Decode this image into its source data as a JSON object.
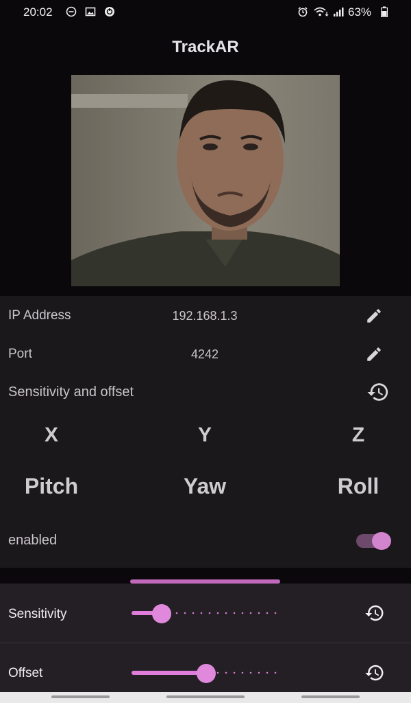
{
  "status_bar": {
    "time": "20:02",
    "battery": "63%",
    "left_icons": [
      "do-not-disturb-icon",
      "image-icon",
      "sync-icon"
    ],
    "right_icons": [
      "alarm-icon",
      "wifi-icon",
      "signal-icon",
      "battery-icon"
    ]
  },
  "app": {
    "title": "TrackAR"
  },
  "settings": {
    "ip": {
      "label": "IP Address",
      "value": "192.168.1.3"
    },
    "port": {
      "label": "Port",
      "value": "4242"
    },
    "sensitivity_offset": {
      "label": "Sensitivity and offset"
    }
  },
  "axes": [
    "X",
    "Y",
    "Z"
  ],
  "rotations": [
    "Pitch",
    "Yaw",
    "Roll"
  ],
  "enabled": {
    "label": "enabled",
    "on": true
  },
  "sheet": {
    "sensitivity": {
      "label": "Sensitivity",
      "value_fraction": 0.2
    },
    "offset": {
      "label": "Offset",
      "value_fraction": 0.5
    }
  },
  "colors": {
    "accent": "#e07ddb",
    "background": "#0b080c",
    "panel": "#1b181c",
    "sheet": "#241f25"
  }
}
